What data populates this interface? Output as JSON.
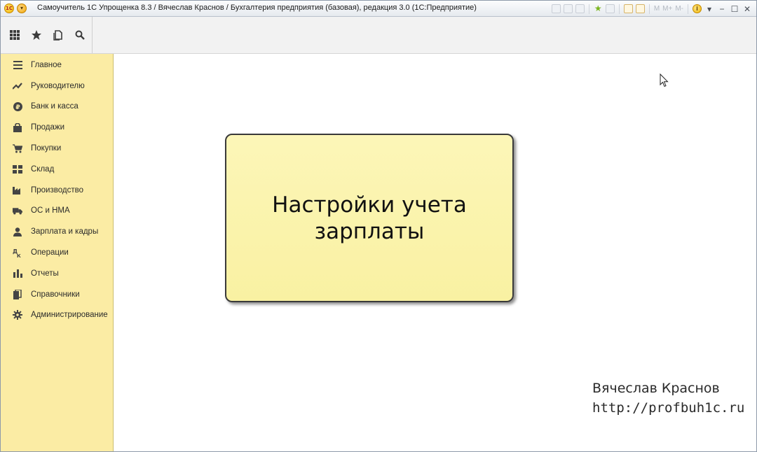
{
  "window": {
    "title": "Самоучитель 1С Упрощенка 8.3 / Вячеслав Краснов / Бухгалтерия предприятия (базовая), редакция 3.0  (1С:Предприятие)",
    "logo_text": "1С",
    "toolbar_memory_labels": [
      "M",
      "M+",
      "M-"
    ]
  },
  "toolbar": {
    "buttons": [
      {
        "name": "apps-grid-icon"
      },
      {
        "name": "favorites-star-icon"
      },
      {
        "name": "history-icon"
      },
      {
        "name": "search-icon"
      }
    ]
  },
  "sidebar": {
    "items": [
      {
        "label": "Главное",
        "icon": "menu-lines-icon"
      },
      {
        "label": "Руководителю",
        "icon": "trend-icon"
      },
      {
        "label": "Банк и касса",
        "icon": "ruble-coin-icon"
      },
      {
        "label": "Продажи",
        "icon": "bag-icon"
      },
      {
        "label": "Покупки",
        "icon": "cart-icon"
      },
      {
        "label": "Склад",
        "icon": "warehouse-icon"
      },
      {
        "label": "Производство",
        "icon": "factory-icon"
      },
      {
        "label": "ОС и НМА",
        "icon": "truck-icon"
      },
      {
        "label": "Зарплата и кадры",
        "icon": "person-icon"
      },
      {
        "label": "Операции",
        "icon": "operations-icon"
      },
      {
        "label": "Отчеты",
        "icon": "bar-chart-icon"
      },
      {
        "label": "Справочники",
        "icon": "books-icon"
      },
      {
        "label": "Администрирование",
        "icon": "gear-icon"
      }
    ]
  },
  "main": {
    "slide_line1": "Настройки учета",
    "slide_line2": "зарплаты",
    "author_name": "Вячеслав Краснов",
    "author_url": "http://profbuh1c.ru"
  },
  "colors": {
    "sidebar_bg": "#fbeca4",
    "slide_bg": "#fcf6b8",
    "toolbar_bg": "#f2f2f2"
  }
}
